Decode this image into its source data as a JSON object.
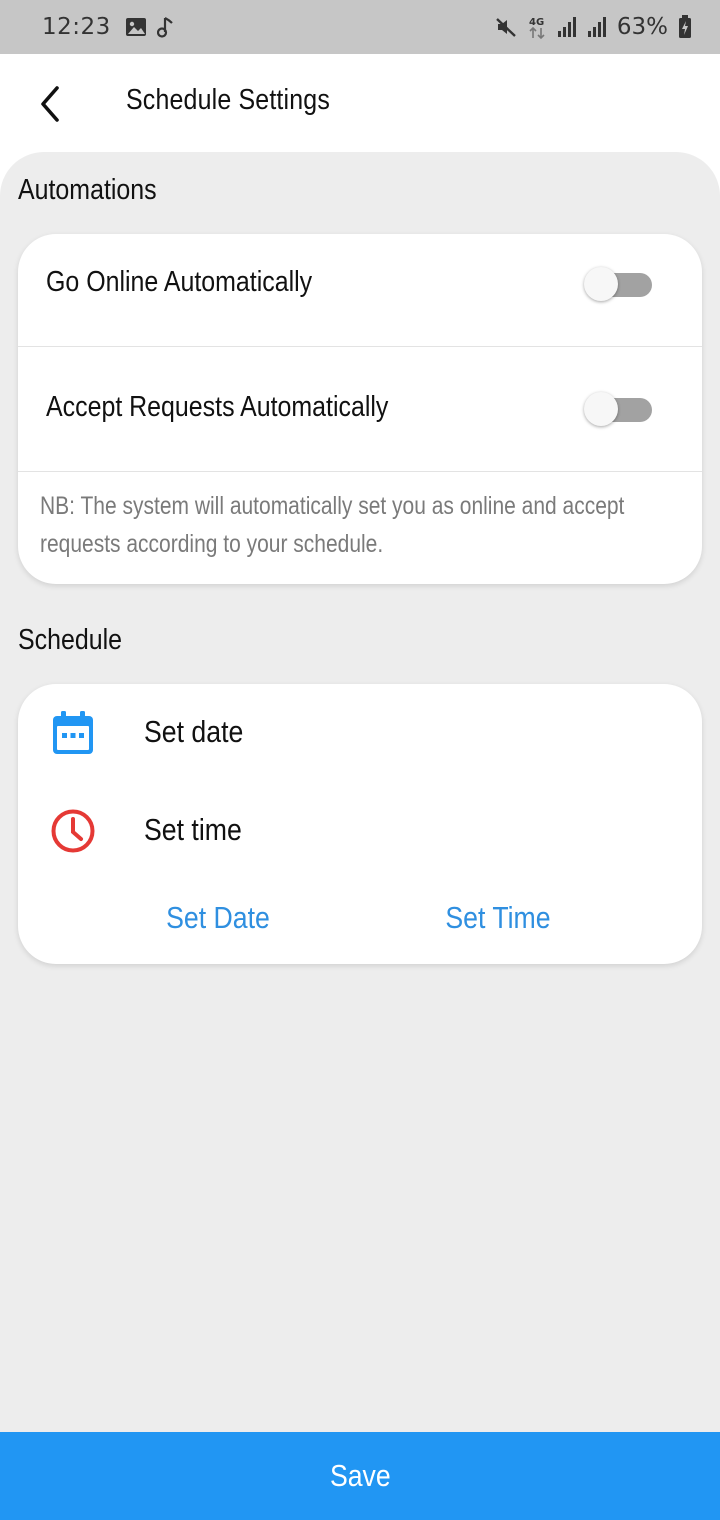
{
  "status_bar": {
    "time": "12:23",
    "battery_percent": "63%",
    "network_type": "4G",
    "left_icons": [
      "image-icon",
      "music-note-icon"
    ],
    "right_icons": [
      "mute-icon",
      "data-arrows-icon",
      "signal-icon",
      "signal-icon",
      "battery-charging-icon"
    ]
  },
  "header": {
    "title": "Schedule Settings",
    "back_icon": "chevron-left-icon"
  },
  "automations": {
    "section_title": "Automations",
    "toggles": [
      {
        "label": "Go Online Automatically",
        "enabled": false
      },
      {
        "label": "Accept Requests Automatically",
        "enabled": false
      }
    ],
    "note": "NB: The system will automatically set you as online and accept requests according to your schedule."
  },
  "schedule": {
    "section_title": "Schedule",
    "items": [
      {
        "label": "Set date",
        "icon": "calendar-icon",
        "color": "#2196f3"
      },
      {
        "label": "Set time",
        "icon": "clock-icon",
        "color": "#e53935"
      }
    ],
    "buttons": {
      "set_date": "Set Date",
      "set_time": "Set Time"
    }
  },
  "footer": {
    "save_label": "Save"
  },
  "colors": {
    "accent": "#2196f3",
    "link": "#2f8fe0",
    "clock": "#e53935",
    "background": "#ededed",
    "status_bar": "#c6c6c6"
  }
}
